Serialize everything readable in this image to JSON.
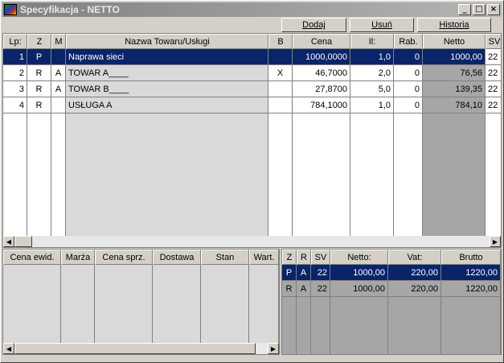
{
  "window": {
    "title": "Specyfikacja - NETTO"
  },
  "titlebar_buttons": {
    "minimize": "_",
    "maximize": "□",
    "close": "×"
  },
  "toolbar": {
    "add": "Dodaj",
    "remove": "Usuń",
    "history": "Historia"
  },
  "main_table": {
    "headers": [
      "Lp:",
      "Z",
      "M",
      "Nazwa Towaru/Usługi",
      "B",
      "Cena",
      "Il:",
      "Rab.",
      "Netto",
      "SV"
    ],
    "rows": [
      {
        "lp": "1",
        "z": "P",
        "m": "",
        "name": "Naprawa sieci",
        "b": "",
        "price": "1000,0000",
        "qty": "1,0",
        "disc": "0",
        "net": "1000,00",
        "sv": "22"
      },
      {
        "lp": "2",
        "z": "R",
        "m": "A",
        "name": "TOWAR A____",
        "b": "X",
        "price": "46,7000",
        "qty": "2,0",
        "disc": "0",
        "net": "76,56",
        "sv": "22"
      },
      {
        "lp": "3",
        "z": "R",
        "m": "A",
        "name": "TOWAR B____",
        "b": "",
        "price": "27,8700",
        "qty": "5,0",
        "disc": "0",
        "net": "139,35",
        "sv": "22"
      },
      {
        "lp": "4",
        "z": "R",
        "m": "",
        "name": "USŁUGA A",
        "b": "",
        "price": "784,1000",
        "qty": "1,0",
        "disc": "0",
        "net": "784,10",
        "sv": "22"
      }
    ]
  },
  "left_table": {
    "headers": [
      "Cena ewid.",
      "Marża",
      "Cena sprz.",
      "Dostawa",
      "Stan",
      "Wart."
    ]
  },
  "right_table": {
    "headers": [
      "Z",
      "R",
      "SV",
      "Netto:",
      "Vat:",
      "Brutto"
    ],
    "rows": [
      {
        "z": "P",
        "r": "A",
        "sv": "22",
        "net": "1000,00",
        "vat": "220,00",
        "gross": "1220,00"
      },
      {
        "z": "R",
        "r": "A",
        "sv": "22",
        "net": "1000,00",
        "vat": "220,00",
        "gross": "1220,00"
      }
    ]
  },
  "colors": {
    "selection": "#0a246a",
    "grey_cell": "#d9d9d9",
    "net_col": "#a6a6a6"
  }
}
